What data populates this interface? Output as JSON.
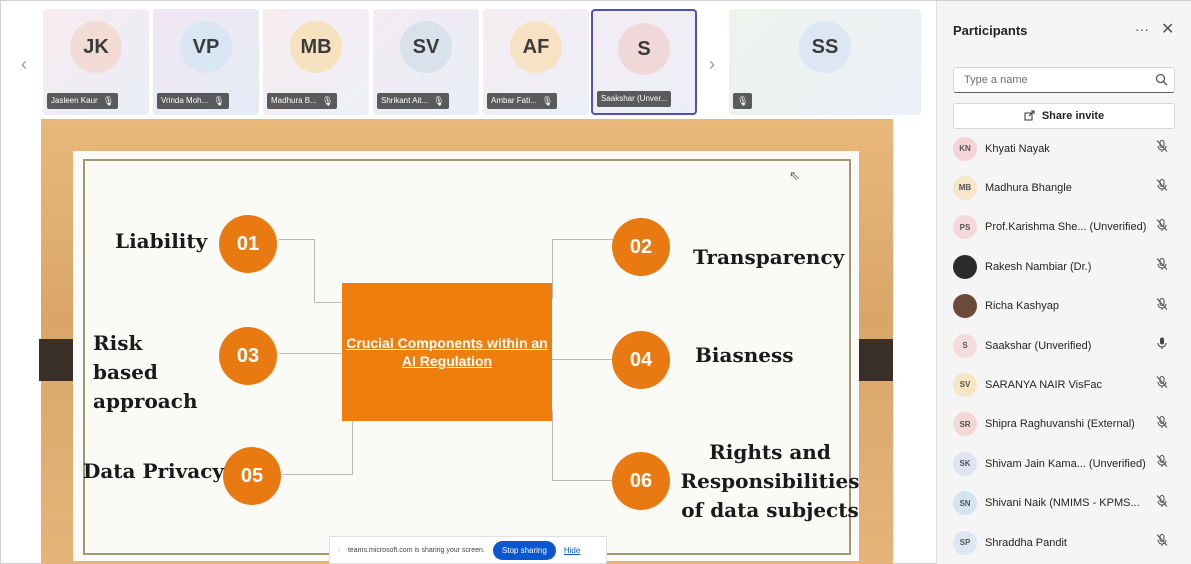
{
  "strip": {
    "prev_arrow": "‹",
    "next_arrow": "›",
    "tiles": [
      {
        "initials": "JK",
        "name": "Jasleen Kaur",
        "avatar_color": "#f4dcd6"
      },
      {
        "initials": "VP",
        "name": "Vrinda Moh...",
        "avatar_color": "#d9e6f3"
      },
      {
        "initials": "MB",
        "name": "Madhura B...",
        "avatar_color": "#f6e2bf"
      },
      {
        "initials": "SV",
        "name": "Shrikant Ait...",
        "avatar_color": "#d8e1ec"
      },
      {
        "initials": "AF",
        "name": "Ambar Fati...",
        "avatar_color": "#f7e2c4"
      },
      {
        "initials": "S",
        "name": "Saakshar (Unver...",
        "avatar_color": "#f0d8d8"
      },
      {
        "initials": "SS",
        "name": "",
        "avatar_color": "#dde6f3"
      }
    ]
  },
  "slide": {
    "center": "Crucial Components within an AI Regulation",
    "items": [
      {
        "num": "01",
        "label": "Liability"
      },
      {
        "num": "02",
        "label": "Transparency"
      },
      {
        "num": "03",
        "label": "Risk based approach"
      },
      {
        "num": "04",
        "label": "Biasness"
      },
      {
        "num": "05",
        "label": "Data Privacy"
      },
      {
        "num": "06",
        "label": "Rights and Responsibilities of data subjects"
      }
    ],
    "accent_color": "#e97a12"
  },
  "share_toast": {
    "message": "teams.microsoft.com is sharing your screen.",
    "stop_label": "Stop sharing",
    "hide_label": "Hide"
  },
  "panel": {
    "title": "Participants",
    "more": "···",
    "close": "✕",
    "search_placeholder": "Type a name",
    "share_invite": "Share invite",
    "participants": [
      {
        "initials": "KN",
        "name": "Khyati Nayak",
        "mic": "muted",
        "avatar_color": "#f4d4d4"
      },
      {
        "initials": "MB",
        "name": "Madhura Bhangle",
        "mic": "muted",
        "avatar_color": "#f6e5c8"
      },
      {
        "initials": "PS",
        "name": "Prof.Karishma She... (Unverified)",
        "mic": "muted",
        "avatar_color": "#f6d8d8"
      },
      {
        "initials": "",
        "name": "Rakesh Nambiar (Dr.)",
        "mic": "muted",
        "avatar_color": "#2b2b2b"
      },
      {
        "initials": "",
        "name": "Richa Kashyap",
        "mic": "muted",
        "avatar_color": "#6b4a3a"
      },
      {
        "initials": "S",
        "name": "Saakshar (Unverified)",
        "mic": "on",
        "avatar_color": "#f3dcdc"
      },
      {
        "initials": "SV",
        "name": "SARANYA NAIR VisFac",
        "mic": "muted",
        "avatar_color": "#f7e5c4"
      },
      {
        "initials": "SR",
        "name": "Shipra Raghuvanshi (External)",
        "mic": "muted",
        "avatar_color": "#f4d8d8"
      },
      {
        "initials": "SK",
        "name": "Shivam Jain Kama... (Unverified)",
        "mic": "muted",
        "avatar_color": "#dfe3f2"
      },
      {
        "initials": "SN",
        "name": "Shivani Naik (NMIMS - KPMS...",
        "mic": "muted",
        "avatar_color": "#d5e4f3"
      },
      {
        "initials": "SP",
        "name": "Shraddha Pandit",
        "mic": "muted",
        "avatar_color": "#dde7f2"
      }
    ]
  }
}
